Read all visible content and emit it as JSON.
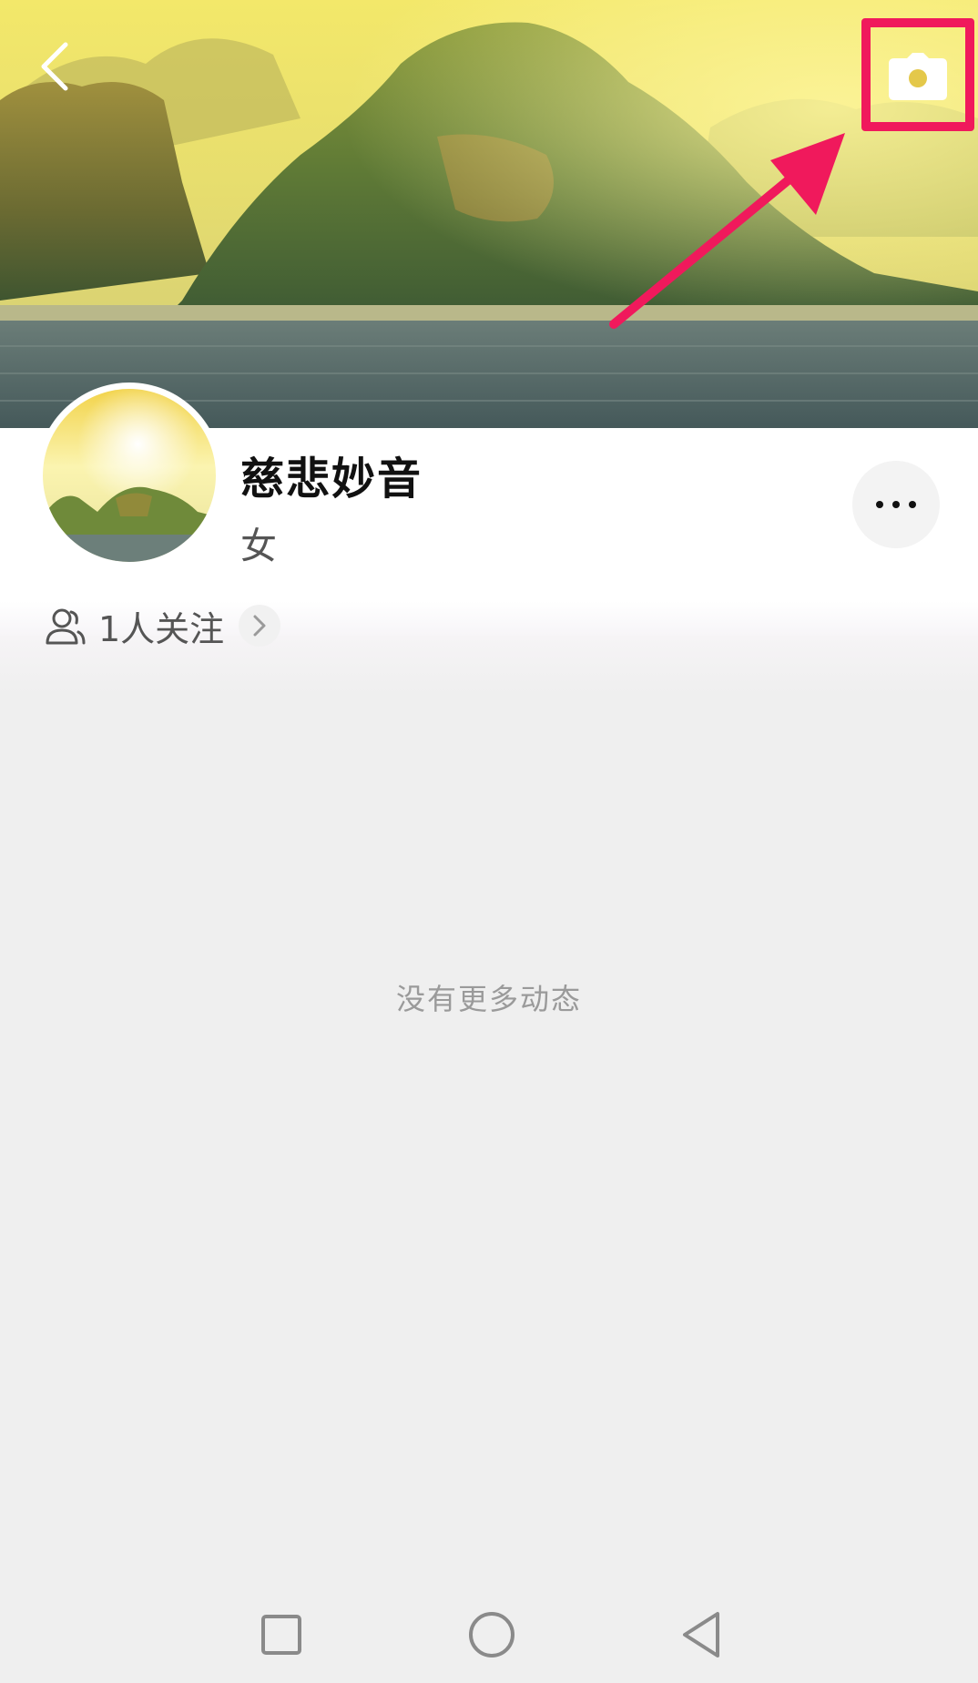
{
  "header": {
    "back_icon": "chevron-left-icon",
    "camera_icon": "camera-icon",
    "cover_image": "mountain-lake-landscape",
    "annotation_color": "#f0195c"
  },
  "profile": {
    "name": "慈悲妙音",
    "gender": "女",
    "follow_text": "1人关注",
    "follow_icon": "user-outline-icon",
    "follow_chevron_icon": "chevron-right-icon",
    "more_icon": "ellipsis-icon"
  },
  "feed": {
    "empty_text": "没有更多动态"
  },
  "nav_bar": {
    "recents_icon": "square-icon",
    "home_icon": "circle-icon",
    "back_icon": "triangle-back-icon"
  }
}
